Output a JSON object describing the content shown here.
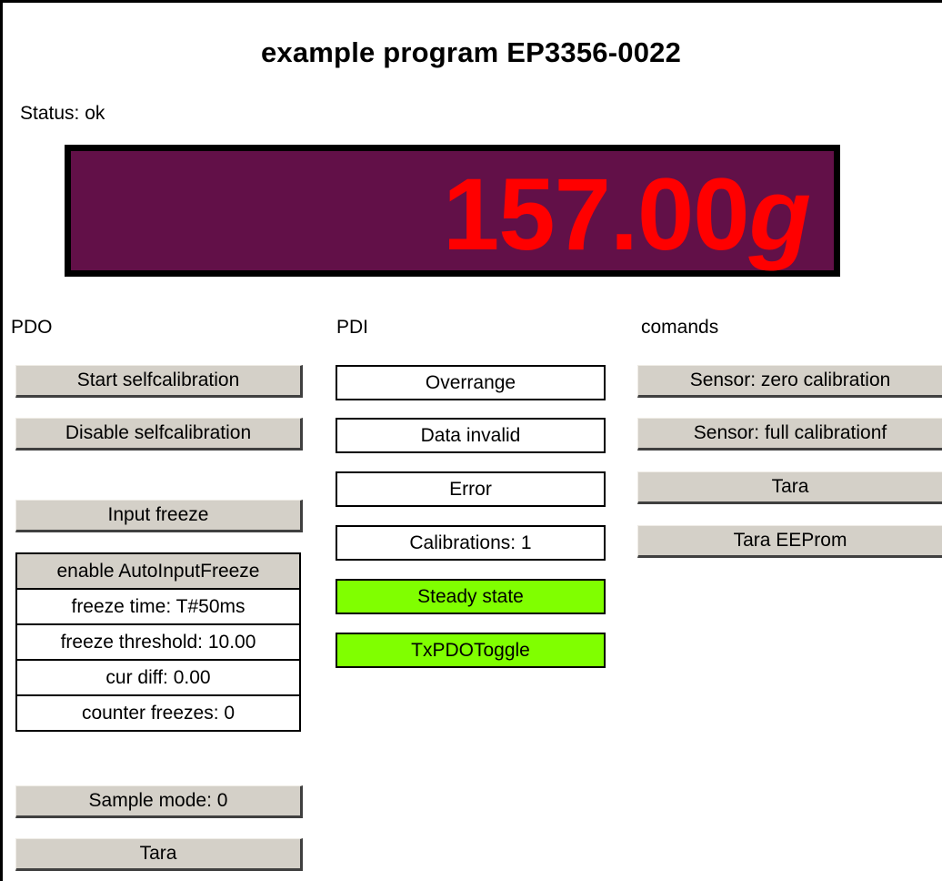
{
  "title": "example program EP3356-0022",
  "status": "Status: ok",
  "display": {
    "value": "157.00",
    "unit": "g",
    "text_color": "#ff0000",
    "bg_color": "#621048"
  },
  "pdo": {
    "label": "PDO",
    "start_selfcalibration": "Start selfcalibration",
    "disable_selfcalibration": "Disable selfcalibration",
    "input_freeze": "Input freeze",
    "freeze_table": {
      "header": "enable AutoInputFreeze",
      "freeze_time": "freeze time: T#50ms",
      "freeze_threshold": "freeze threshold:  10.00",
      "cur_diff": "cur diff:  0.00",
      "counter_freezes": "counter freezes: 0"
    },
    "sample_mode": "Sample mode: 0",
    "tara": "Tara"
  },
  "pdi": {
    "label": "PDI",
    "overrange": "Overrange",
    "data_invalid": "Data invalid",
    "error": "Error",
    "calibrations": "Calibrations: 1",
    "steady_state": "Steady state",
    "txpdo_toggle": "TxPDOToggle",
    "active_color": "#80ff00"
  },
  "commands": {
    "label": "comands",
    "sensor_zero": "Sensor: zero calibration",
    "sensor_full": "Sensor: full calibrationf",
    "tara": "Tara",
    "tara_eeprom": "Tara EEProm"
  }
}
